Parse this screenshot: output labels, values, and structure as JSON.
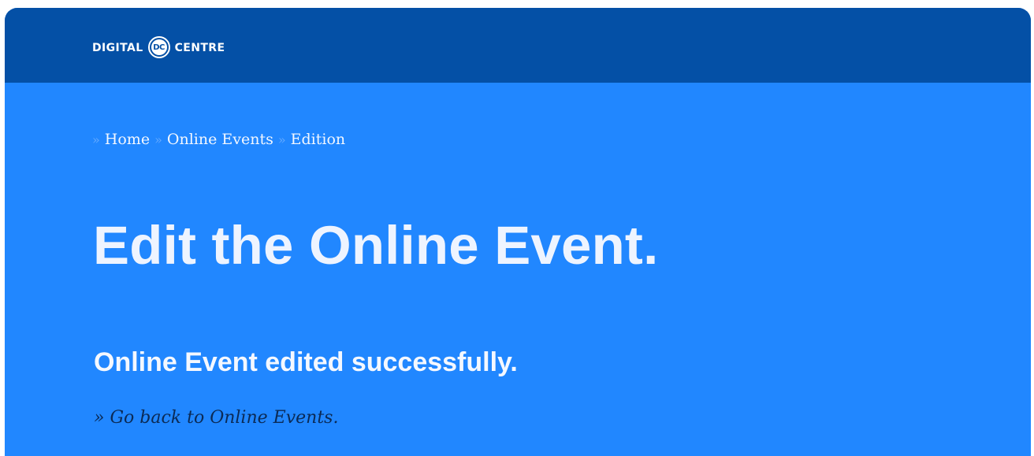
{
  "header": {
    "logo": {
      "left_text": "DIGITAL",
      "mark_text": "DC",
      "right_text": "CENTRE"
    }
  },
  "breadcrumb": {
    "separator": "»",
    "items": [
      {
        "label": "Home"
      },
      {
        "label": "Online Events"
      },
      {
        "label": "Edition"
      }
    ]
  },
  "main": {
    "title": "Edit the Online Event.",
    "success_message": "Online Event edited successfully.",
    "back_link": "» Go back to Online Events."
  },
  "colors": {
    "topbar": "#0450a6",
    "content_background": "#2187ff",
    "link_dark": "#0b2a55"
  },
  "icons": {
    "logo_mark": "dc-circle-logo-icon"
  }
}
